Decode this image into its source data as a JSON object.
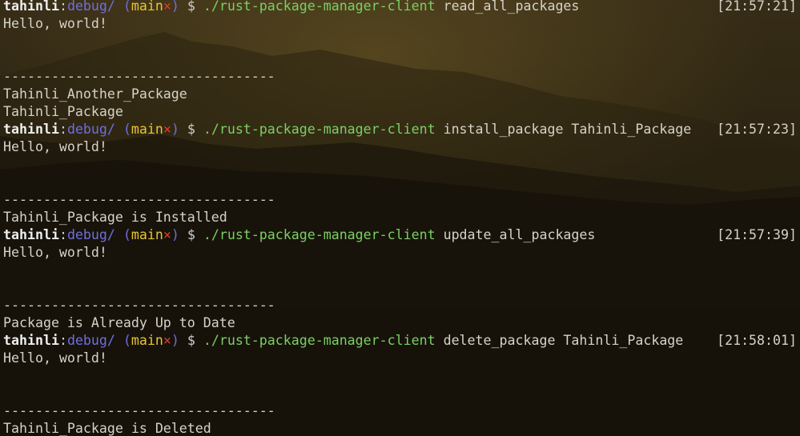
{
  "prompt": {
    "user": "tahinli",
    "colon": ":",
    "dir": "debug/",
    "paren_open": "(",
    "branch": "main",
    "dirty_mark": "×",
    "paren_close": ")",
    "dollar": "$",
    "command": "./rust-package-manager-client"
  },
  "entries": [
    {
      "args": "read_all_packages",
      "time": "[21:57:21]",
      "greeting": "Hello, world!",
      "separator": "----------------------------------",
      "results": [
        "Tahinli_Another_Package",
        "Tahinli_Package"
      ]
    },
    {
      "args": "install_package Tahinli_Package",
      "time": "[21:57:23]",
      "greeting": "Hello, world!",
      "separator": "----------------------------------",
      "results": [
        "Tahinli_Package is Installed"
      ]
    },
    {
      "args": "update_all_packages",
      "time": "[21:57:39]",
      "greeting": "Hello, world!",
      "separator": "----------------------------------",
      "results": [
        "Package is Already Up to Date"
      ]
    },
    {
      "args": "delete_package Tahinli_Package",
      "time": "[21:58:01]",
      "greeting": "Hello, world!",
      "separator": "----------------------------------",
      "results": [
        "Tahinli_Package is Deleted"
      ]
    }
  ],
  "colors": {
    "user": "#eeeeee",
    "dir": "#6f6ee0",
    "branch": "#e7c531",
    "dirty": "#e83a2a",
    "command": "#7bcf64",
    "text": "#d6d2c8",
    "background": "#241d10"
  }
}
